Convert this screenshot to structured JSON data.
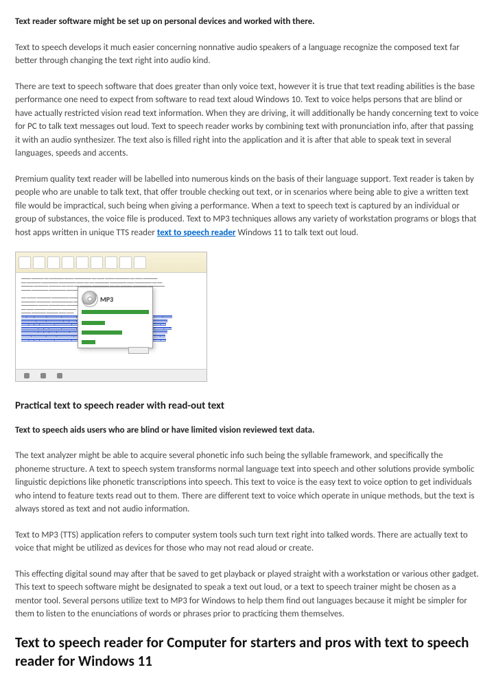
{
  "intro_bold": "Text reader software might be set up on personal devices and worked with there.",
  "para1": "Text to speech develops it much easier concerning nonnative audio speakers of a language recognize the composed text far better through changing the text right into audio kind.",
  "para2": "There are text to speech software that does greater than only voice text, however it is true that text reading abilities is the base performance one need to expect from software to read text aloud Windows 10. Text to voice helps persons that are blind or have actually restricted vision read text information. When they are driving, it will additionally be handy concerning text to voice for PC to talk text messages out loud. Text to speech reader works by combining text with pronunciation info, after that passing it with an audio synthesizer. The text also is filled right into the application and it is after that able to speak text in several languages, speeds and accents.",
  "para3_a": "Premium quality text reader will be labelled into numerous kinds on the basis of their language support. Text reader is taken by people who are unable to talk text, that offer trouble checking out text, or in scenarios where being able to give a written text file would be impractical, such being when giving a performance. When a text to speech text is captured by an individual or group of substances, the voice file is produced. Text to MP3 techniques allows any variety of workstation programs or blogs that host apps written in unique TTS reader ",
  "link_text": "text to speech reader",
  "para3_b": " Windows 11 to talk text out loud.",
  "mp3_label": "MP3",
  "section_heading": "Practical text to speech reader with read-out text",
  "sub_bold": "Text to speech aids users who are blind or have limited vision reviewed text data.",
  "para4": "The text analyzer might be able to acquire several phonetic info such being the syllable framework, and specifically the phoneme structure. A text to speech system transforms normal language text into speech and other solutions provide symbolic linguistic depictions like phonetic transcriptions into speech. This text to voice is the easy text to voice option to get individuals who intend to feature texts read out to them. There are different text to voice which operate in unique methods, but the text is always stored as text and not audio information.",
  "para5": "Text to MP3 (TTS) application refers to computer system tools such turn text right into talked words. There are actually text to voice that might be utilized as devices for those who may not read aloud or create.",
  "para6": "This effecting digital sound may after that be saved to get playback or played straight with a workstation or various other gadget. This text to speech software might be designated to speak a text out loud, or a text to speech trainer might be chosen as a mentor tool. Several persons utilize text to MP3 for Windows to help them find out languages because it might be simpler for them to listen to the enunciations of words or phrases prior to practicing them themselves.",
  "big_heading": "Text to speech reader for Computer for starters and pros with text to speech reader for Windows 11"
}
